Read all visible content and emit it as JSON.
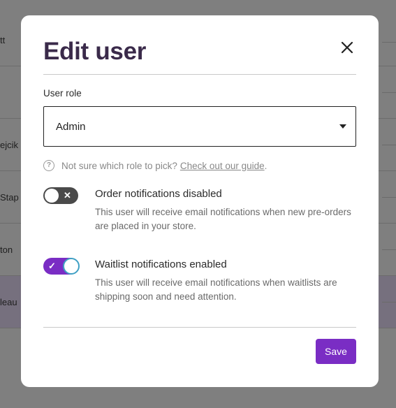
{
  "background_rows": [
    {
      "fragment": "tt"
    },
    {
      "fragment": ""
    },
    {
      "fragment": "ejcik"
    },
    {
      "fragment": " Stap"
    },
    {
      "fragment": "ton"
    },
    {
      "fragment": "leau"
    }
  ],
  "modal": {
    "title": "Edit user",
    "close_icon": "close-icon",
    "role_field": {
      "label": "User role",
      "value": "Admin"
    },
    "help": {
      "icon": "?",
      "text": "Not sure which role to pick?",
      "link": "Check out our guide",
      "suffix": "."
    },
    "options": [
      {
        "title": "Order notifications disabled",
        "description": "This user will receive email notifications when new pre-orders are placed in your store.",
        "enabled": false,
        "glyph": "✕"
      },
      {
        "title": "Waitlist notifications enabled",
        "description": "This user will receive email notifications when waitlists are shipping soon and need attention.",
        "enabled": true,
        "glyph": "✓"
      }
    ],
    "save_label": "Save"
  },
  "colors": {
    "accent": "#7a2dc4",
    "focus_ring": "#3fa0c4",
    "title": "#3a2a4a",
    "overlay": "#7f7f7f"
  }
}
